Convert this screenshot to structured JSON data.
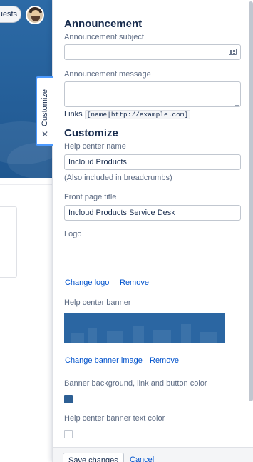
{
  "background": {
    "requests_label": "uests",
    "colors": {
      "banner": "#245e98"
    }
  },
  "customize_tab": {
    "label": "Customize",
    "close_icon": "close-icon"
  },
  "announcement": {
    "title": "Announcement",
    "subject_label": "Announcement subject",
    "subject_value": "",
    "message_label": "Announcement message",
    "message_value": "",
    "links_label": "Links",
    "links_syntax": "[name|http://example.com]"
  },
  "customize": {
    "title": "Customize",
    "help_center_name_label": "Help center name",
    "help_center_name_value": "Incloud Products",
    "breadcrumbs_note": "(Also included in breadcrumbs)",
    "front_page_title_label": "Front page title",
    "front_page_title_value": "Incloud Products Service Desk",
    "logo_label": "Logo",
    "change_logo": "Change logo",
    "remove_logo": "Remove",
    "banner_label": "Help center banner",
    "change_banner": "Change banner image",
    "remove_banner": "Remove",
    "banner_color_label": "Banner background, link and button color",
    "banner_color": "#2d5f94",
    "banner_text_color_label": "Help center banner text color",
    "banner_text_color": "#ffffff"
  },
  "footer": {
    "save_label": "Save changes",
    "cancel_label": "Cancel"
  }
}
